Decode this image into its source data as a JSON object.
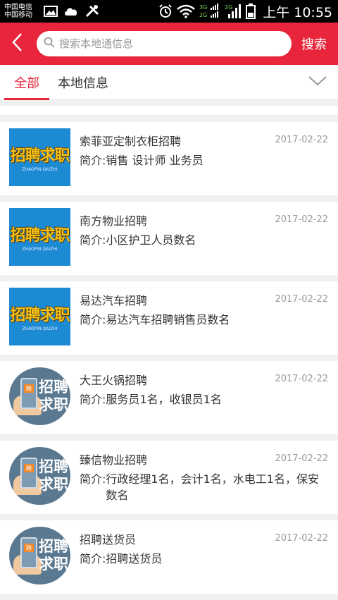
{
  "status_bar": {
    "carrier_1": "中国电信",
    "carrier_2": "中国移动",
    "net_label_1a": "3G",
    "net_label_1b": "2G",
    "net_label_2": "2G",
    "time": "上午 10:55"
  },
  "header": {
    "search_placeholder": "搜索本地通信息",
    "search_button": "搜索"
  },
  "tabs": {
    "all": "全部",
    "local": "本地信息"
  },
  "colors": {
    "brand_red": "#e8253a",
    "thumb_blue": "#1d8ad4",
    "thumb_yellow": "#f6c21a"
  },
  "thumb_rect_text": {
    "big": "招聘求职",
    "small": "ZHAOPIN QIUZHI"
  },
  "thumb_circle_text": {
    "screen": "聘",
    "line1": "招聘",
    "line2": "求职"
  },
  "desc_prefix": "简介:",
  "items": [
    {
      "title": "索菲亚定制衣柜招聘",
      "date": "2017-02-22",
      "desc": "销售  设计师 业务员",
      "thumb": "rect"
    },
    {
      "title": "南方物业招聘",
      "date": "2017-02-22",
      "desc": "小区护卫人员数名",
      "thumb": "rect"
    },
    {
      "title": "易达汽车招聘",
      "date": "2017-02-22",
      "desc": "易达汽车招聘销售员数名",
      "thumb": "rect"
    },
    {
      "title": "大王火锅招聘",
      "date": "2017-02-22",
      "desc": "服务员1名，收银员1名",
      "thumb": "circle"
    },
    {
      "title": "臻信物业招聘",
      "date": "2017-02-22",
      "desc": "行政经理1名，会计1名，水电工1名，保安数名",
      "thumb": "circle"
    },
    {
      "title": "招聘送货员",
      "date": "2017-02-22",
      "desc": "招聘送货员",
      "thumb": "circle"
    }
  ]
}
